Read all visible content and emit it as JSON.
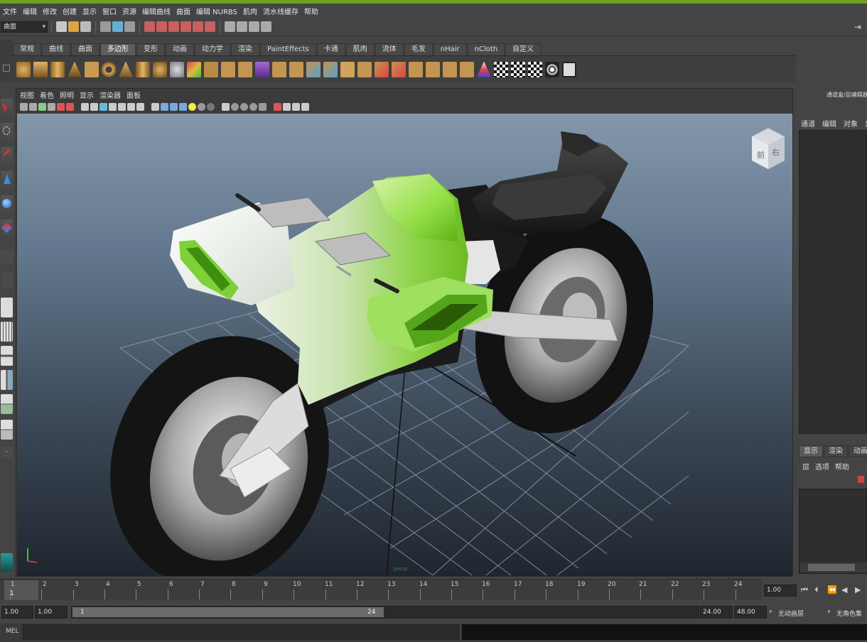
{
  "menubar": {
    "items": [
      "文件",
      "编辑",
      "修改",
      "创建",
      "显示",
      "窗口",
      "资源",
      "编辑曲线",
      "曲面",
      "编辑 NURBS",
      "肌肉",
      "流水线缓存",
      "帮助"
    ]
  },
  "statusline": {
    "mode": "曲面"
  },
  "shelf": {
    "tabs": [
      "常规",
      "曲线",
      "曲面",
      "多边形",
      "变形",
      "动画",
      "动力学",
      "渲染",
      "PaintEffects",
      "卡通",
      "肌肉",
      "流体",
      "毛发",
      "nHair",
      "nCloth",
      "自定义"
    ],
    "active_tab": "多边形"
  },
  "viewport": {
    "menu": [
      "视图",
      "着色",
      "照明",
      "显示",
      "渲染器",
      "面板"
    ],
    "viewcube": {
      "front_label": "前",
      "right_label": "右"
    },
    "corner_label": "persp"
  },
  "right_panel": {
    "title": "通道盒/层编辑器",
    "menu": [
      "通道",
      "编辑",
      "对象",
      "显示"
    ],
    "tabs": [
      "显示",
      "渲染",
      "动画"
    ],
    "layer_menu": [
      "层",
      "选项",
      "帮助"
    ]
  },
  "timeline": {
    "ticks": [
      "1",
      "2",
      "3",
      "4",
      "5",
      "6",
      "7",
      "8",
      "9",
      "10",
      "11",
      "12",
      "13",
      "14",
      "15",
      "16",
      "17",
      "18",
      "19",
      "20",
      "21",
      "22",
      "23",
      "24"
    ],
    "current_frame": "1",
    "current_time": "1.00"
  },
  "range": {
    "start_time": "1.00",
    "playback_start": "1.00",
    "slider_start": "1",
    "slider_end": "24",
    "playback_end": "24.00",
    "end_time": "48.00",
    "anim_layer": "无动画层",
    "character_set": "无角色集"
  },
  "command": {
    "label": "MEL"
  },
  "colors": {
    "accent": "#6fa020",
    "body_green": "#7ccb2a",
    "body_white": "#e8f0e2",
    "rubber": "#161616",
    "grid": "#9aa8bd"
  }
}
